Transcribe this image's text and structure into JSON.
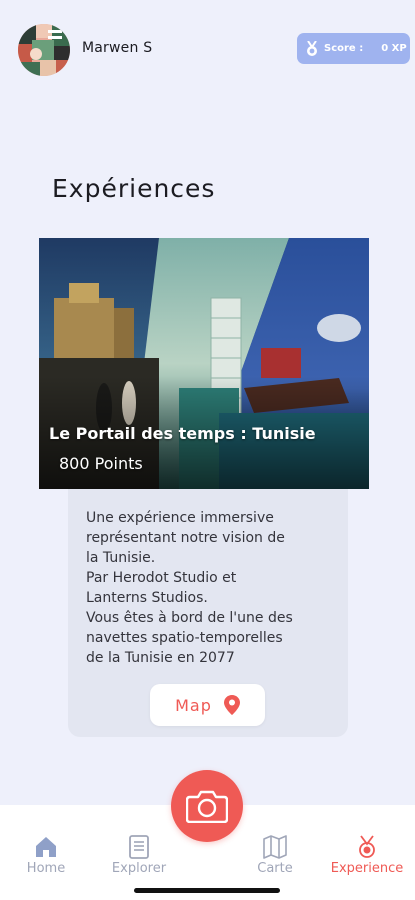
{
  "header": {
    "username": "Marwen S",
    "score_label": "Score :",
    "score_value": "0 XP"
  },
  "page": {
    "title": "Expériences"
  },
  "experience": {
    "title": "Le Portail des temps : Tunisie",
    "points": "800 Points",
    "description_lines": [
      "Une expérience immersive",
      "représentant notre vision de",
      "la Tunisie.",
      "Par Herodot Studio et",
      "Lanterns Studios.",
      "Vous êtes à bord de l'une des",
      "navettes spatio-temporelles",
      "de la Tunisie en 2077"
    ],
    "map_label": "Map"
  },
  "nav": {
    "items": [
      {
        "label": "Home",
        "icon": "home-icon"
      },
      {
        "label": "Explorer",
        "icon": "document-icon"
      },
      {
        "label": "Carte",
        "icon": "map-icon"
      },
      {
        "label": "Experience",
        "icon": "medal-icon"
      }
    ],
    "active": "Experience",
    "camera_icon": "camera-icon"
  },
  "colors": {
    "accent": "#ef5a55",
    "score_badge": "#9fb3ef",
    "background": "#eef0fb",
    "inactive_nav": "#a0a6b8"
  }
}
